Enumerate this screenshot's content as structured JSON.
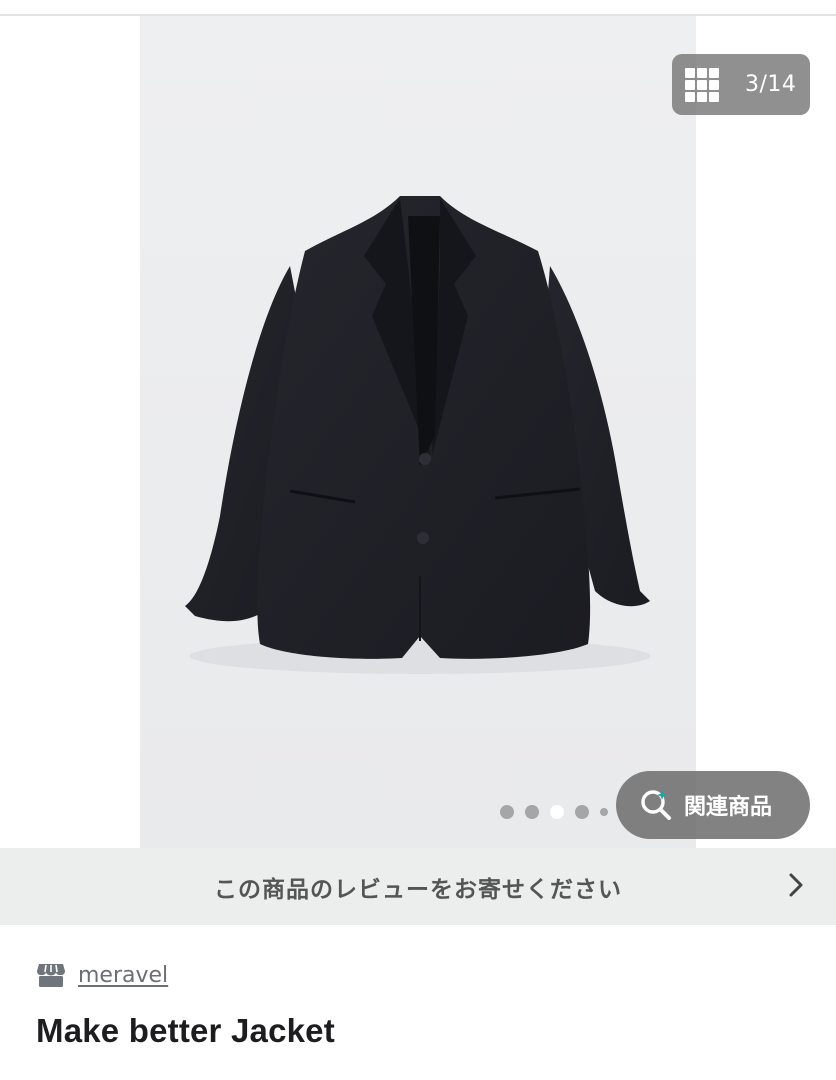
{
  "gallery": {
    "counter": "3/14",
    "counter_icon": "grid-icon",
    "dots": [
      {
        "state": "inactive"
      },
      {
        "state": "inactive"
      },
      {
        "state": "active"
      },
      {
        "state": "inactive"
      },
      {
        "state": "inactive-small"
      }
    ],
    "related_button": {
      "label": "関連商品",
      "icon": "search-sparkle-icon"
    }
  },
  "review_banner": {
    "text": "この商品のレビューをお寄せください",
    "icon": "chevron-right-icon"
  },
  "shop": {
    "icon": "shop-icon",
    "name": "meravel"
  },
  "product": {
    "title": "Make better Jacket"
  },
  "colors": {
    "accent": "#1ca7a0",
    "photo_background": "#ececee",
    "banner_background": "#eceeee",
    "title_text": "#1d1d1f"
  }
}
